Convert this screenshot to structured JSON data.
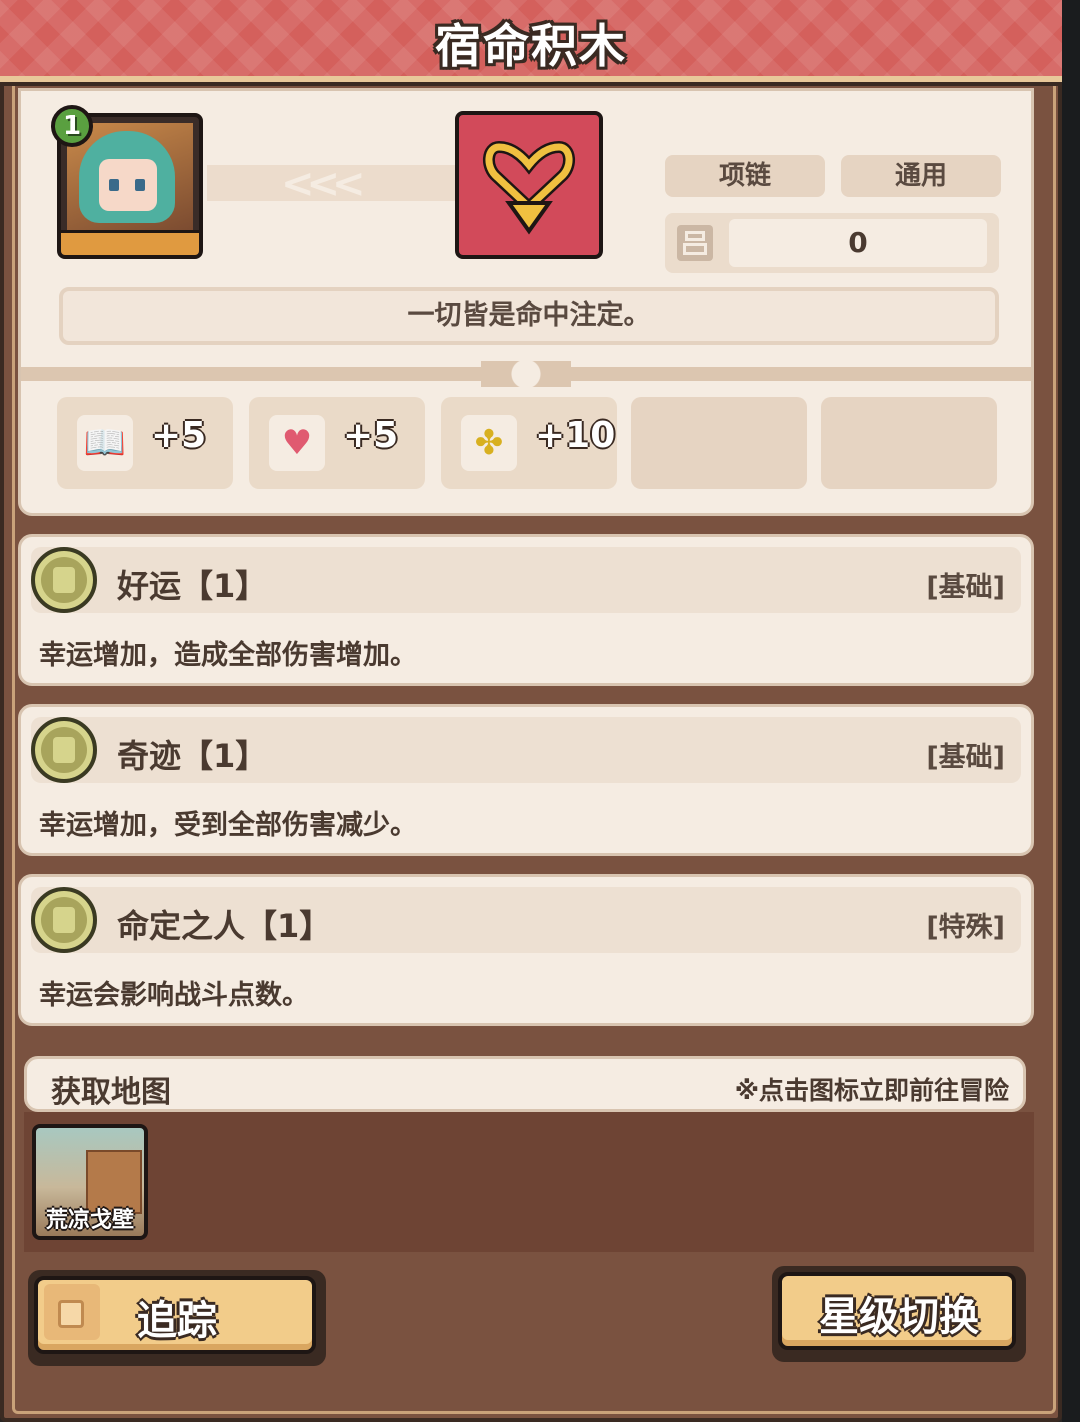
{
  "header": {
    "title": "宿命积木"
  },
  "character": {
    "level": "1"
  },
  "item": {
    "icon": "heart-necklace-icon",
    "tags": [
      "项链",
      "通用"
    ],
    "count": "0",
    "motto": "一切皆是命中注定。"
  },
  "stats": [
    {
      "icon": "book-icon",
      "value": "+5"
    },
    {
      "icon": "heart-icon",
      "value": "+5"
    },
    {
      "icon": "luck-clover-icon",
      "value": "+10"
    }
  ],
  "skills": [
    {
      "name": "好运【1】",
      "kind": "[基础]",
      "desc": "幸运增加，造成全部伤害增加。",
      "icon": "shield-emblem-icon"
    },
    {
      "name": "奇迹【1】",
      "kind": "[基础]",
      "desc": "幸运增加，受到全部伤害减少。",
      "icon": "cross-emblem-icon"
    },
    {
      "name": "命定之人【1】",
      "kind": "[特殊]",
      "desc": "幸运会影响战斗点数。",
      "icon": "flask-emblem-icon"
    }
  ],
  "map": {
    "title": "获取地图",
    "hint": "※点击图标立即前往冒险",
    "locations": [
      {
        "label": "荒凉戈壁"
      }
    ]
  },
  "buttons": {
    "track": "追踪",
    "star_switch": "星级切换"
  }
}
